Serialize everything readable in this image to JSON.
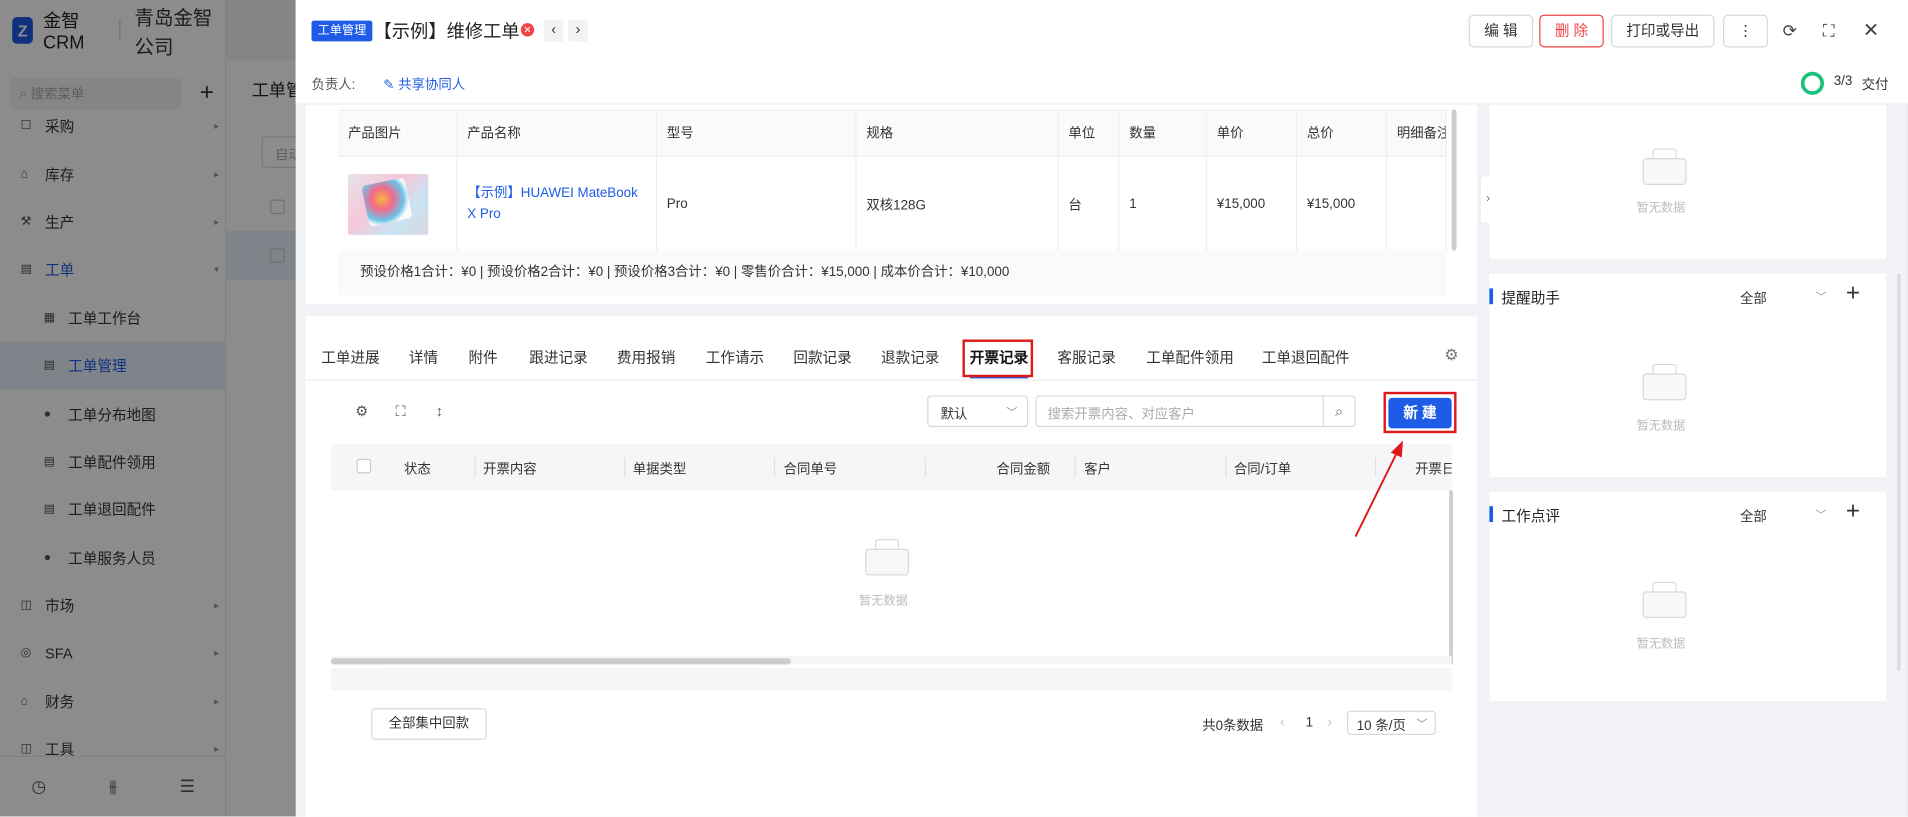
{
  "sidebar": {
    "brand_logo": "Z",
    "brand_name": "金智CRM",
    "company": "青岛金智公司",
    "search_placeholder": "搜索菜单",
    "menu": [
      {
        "label": "采购",
        "icon": "cart-icon",
        "glyph": "☐",
        "has_arrow": true,
        "level": 1,
        "state": ""
      },
      {
        "label": "库存",
        "icon": "warehouse-icon",
        "glyph": "⌂",
        "has_arrow": true,
        "level": 1,
        "state": ""
      },
      {
        "label": "生产",
        "icon": "factory-icon",
        "glyph": "⚒",
        "has_arrow": true,
        "level": 1,
        "state": ""
      },
      {
        "label": "工单",
        "icon": "ticket-icon",
        "glyph": "▤",
        "has_arrow": true,
        "level": 1,
        "state": "open",
        "arrow_down": true
      },
      {
        "label": "工单工作台",
        "icon": "dashboard-icon",
        "glyph": "▦",
        "has_arrow": false,
        "level": 2,
        "state": ""
      },
      {
        "label": "工单管理",
        "icon": "document-icon",
        "glyph": "▤",
        "has_arrow": false,
        "level": 2,
        "state": "active"
      },
      {
        "label": "工单分布地图",
        "icon": "person-icon",
        "glyph": "●",
        "has_arrow": false,
        "level": 2,
        "state": ""
      },
      {
        "label": "工单配件领用",
        "icon": "file-icon",
        "glyph": "▤",
        "has_arrow": false,
        "level": 2,
        "state": ""
      },
      {
        "label": "工单退回配件",
        "icon": "file-icon",
        "glyph": "▤",
        "has_arrow": false,
        "level": 2,
        "state": ""
      },
      {
        "label": "工单服务人员",
        "icon": "person-icon",
        "glyph": "●",
        "has_arrow": false,
        "level": 2,
        "state": ""
      },
      {
        "label": "市场",
        "icon": "market-icon",
        "glyph": "◫",
        "has_arrow": true,
        "level": 1,
        "state": ""
      },
      {
        "label": "SFA",
        "icon": "target-icon",
        "glyph": "◎",
        "has_arrow": true,
        "level": 1,
        "state": ""
      },
      {
        "label": "财务",
        "icon": "bank-icon",
        "glyph": "⌂",
        "has_arrow": true,
        "level": 1,
        "state": ""
      },
      {
        "label": "工具",
        "icon": "toolbox-icon",
        "glyph": "◫",
        "has_arrow": true,
        "level": 1,
        "state": ""
      }
    ]
  },
  "background": {
    "page_title": "工单管",
    "filter_box": "自动"
  },
  "drawer": {
    "tag": "工单管理",
    "title": "【示例】维修工单",
    "owner_label": "负责人:",
    "share_label": "共享协同人",
    "buttons": {
      "edit": "编 辑",
      "delete": "删 除",
      "print": "打印或导出",
      "more": "⋮"
    },
    "progress": {
      "text": "3/3",
      "stage": "交付",
      "ring_color": "#19c27a"
    }
  },
  "product_table": {
    "columns": [
      "产品图片",
      "产品名称",
      "型号",
      "规格",
      "单位",
      "数量",
      "单价",
      "总价",
      "明细备注"
    ],
    "row": {
      "name": "【示例】HUAWEI MateBook X Pro",
      "model": "Pro",
      "spec": "双核128G",
      "unit": "台",
      "qty": "1",
      "price": "¥15,000",
      "total": "¥15,000",
      "note": ""
    },
    "summary": "预设价格1合计：¥0 |   预设价格2合计：¥0 |   预设价格3合计：¥0 |   零售价合计：¥15,000 |   成本价合计：¥10,000"
  },
  "tabs": [
    {
      "label": "工单进展"
    },
    {
      "label": "详情"
    },
    {
      "label": "附件"
    },
    {
      "label": "跟进记录"
    },
    {
      "label": "费用报销"
    },
    {
      "label": "工作请示"
    },
    {
      "label": "回款记录"
    },
    {
      "label": "退款记录"
    },
    {
      "label": "开票记录",
      "active": true
    },
    {
      "label": "客服记录"
    },
    {
      "label": "工单配件领用"
    },
    {
      "label": "工单退回配件"
    }
  ],
  "invoice": {
    "sort_value": "默认",
    "search_placeholder": "搜索开票内容、对应客户",
    "new_button": "新 建",
    "columns": [
      "状态",
      "开票内容",
      "单据类型",
      "合同单号",
      "合同金额",
      "客户",
      "合同/订单",
      "开票日"
    ],
    "empty_text": "暂无数据",
    "footer_button": "全部集中回款",
    "total_text": "共0条数据",
    "page": "1",
    "page_size": "10 条/页"
  },
  "right_panels": {
    "top_empty_text": "暂无数据",
    "reminder": {
      "title": "提醒助手",
      "filter": "全部",
      "empty_text": "暂无数据"
    },
    "review": {
      "title": "工作点评",
      "filter": "全部",
      "empty_text": "暂无数据"
    }
  },
  "colors": {
    "primary": "#1e5be6",
    "danger": "#f04545",
    "success": "#19c27a",
    "annotation": "#e01a1a"
  }
}
